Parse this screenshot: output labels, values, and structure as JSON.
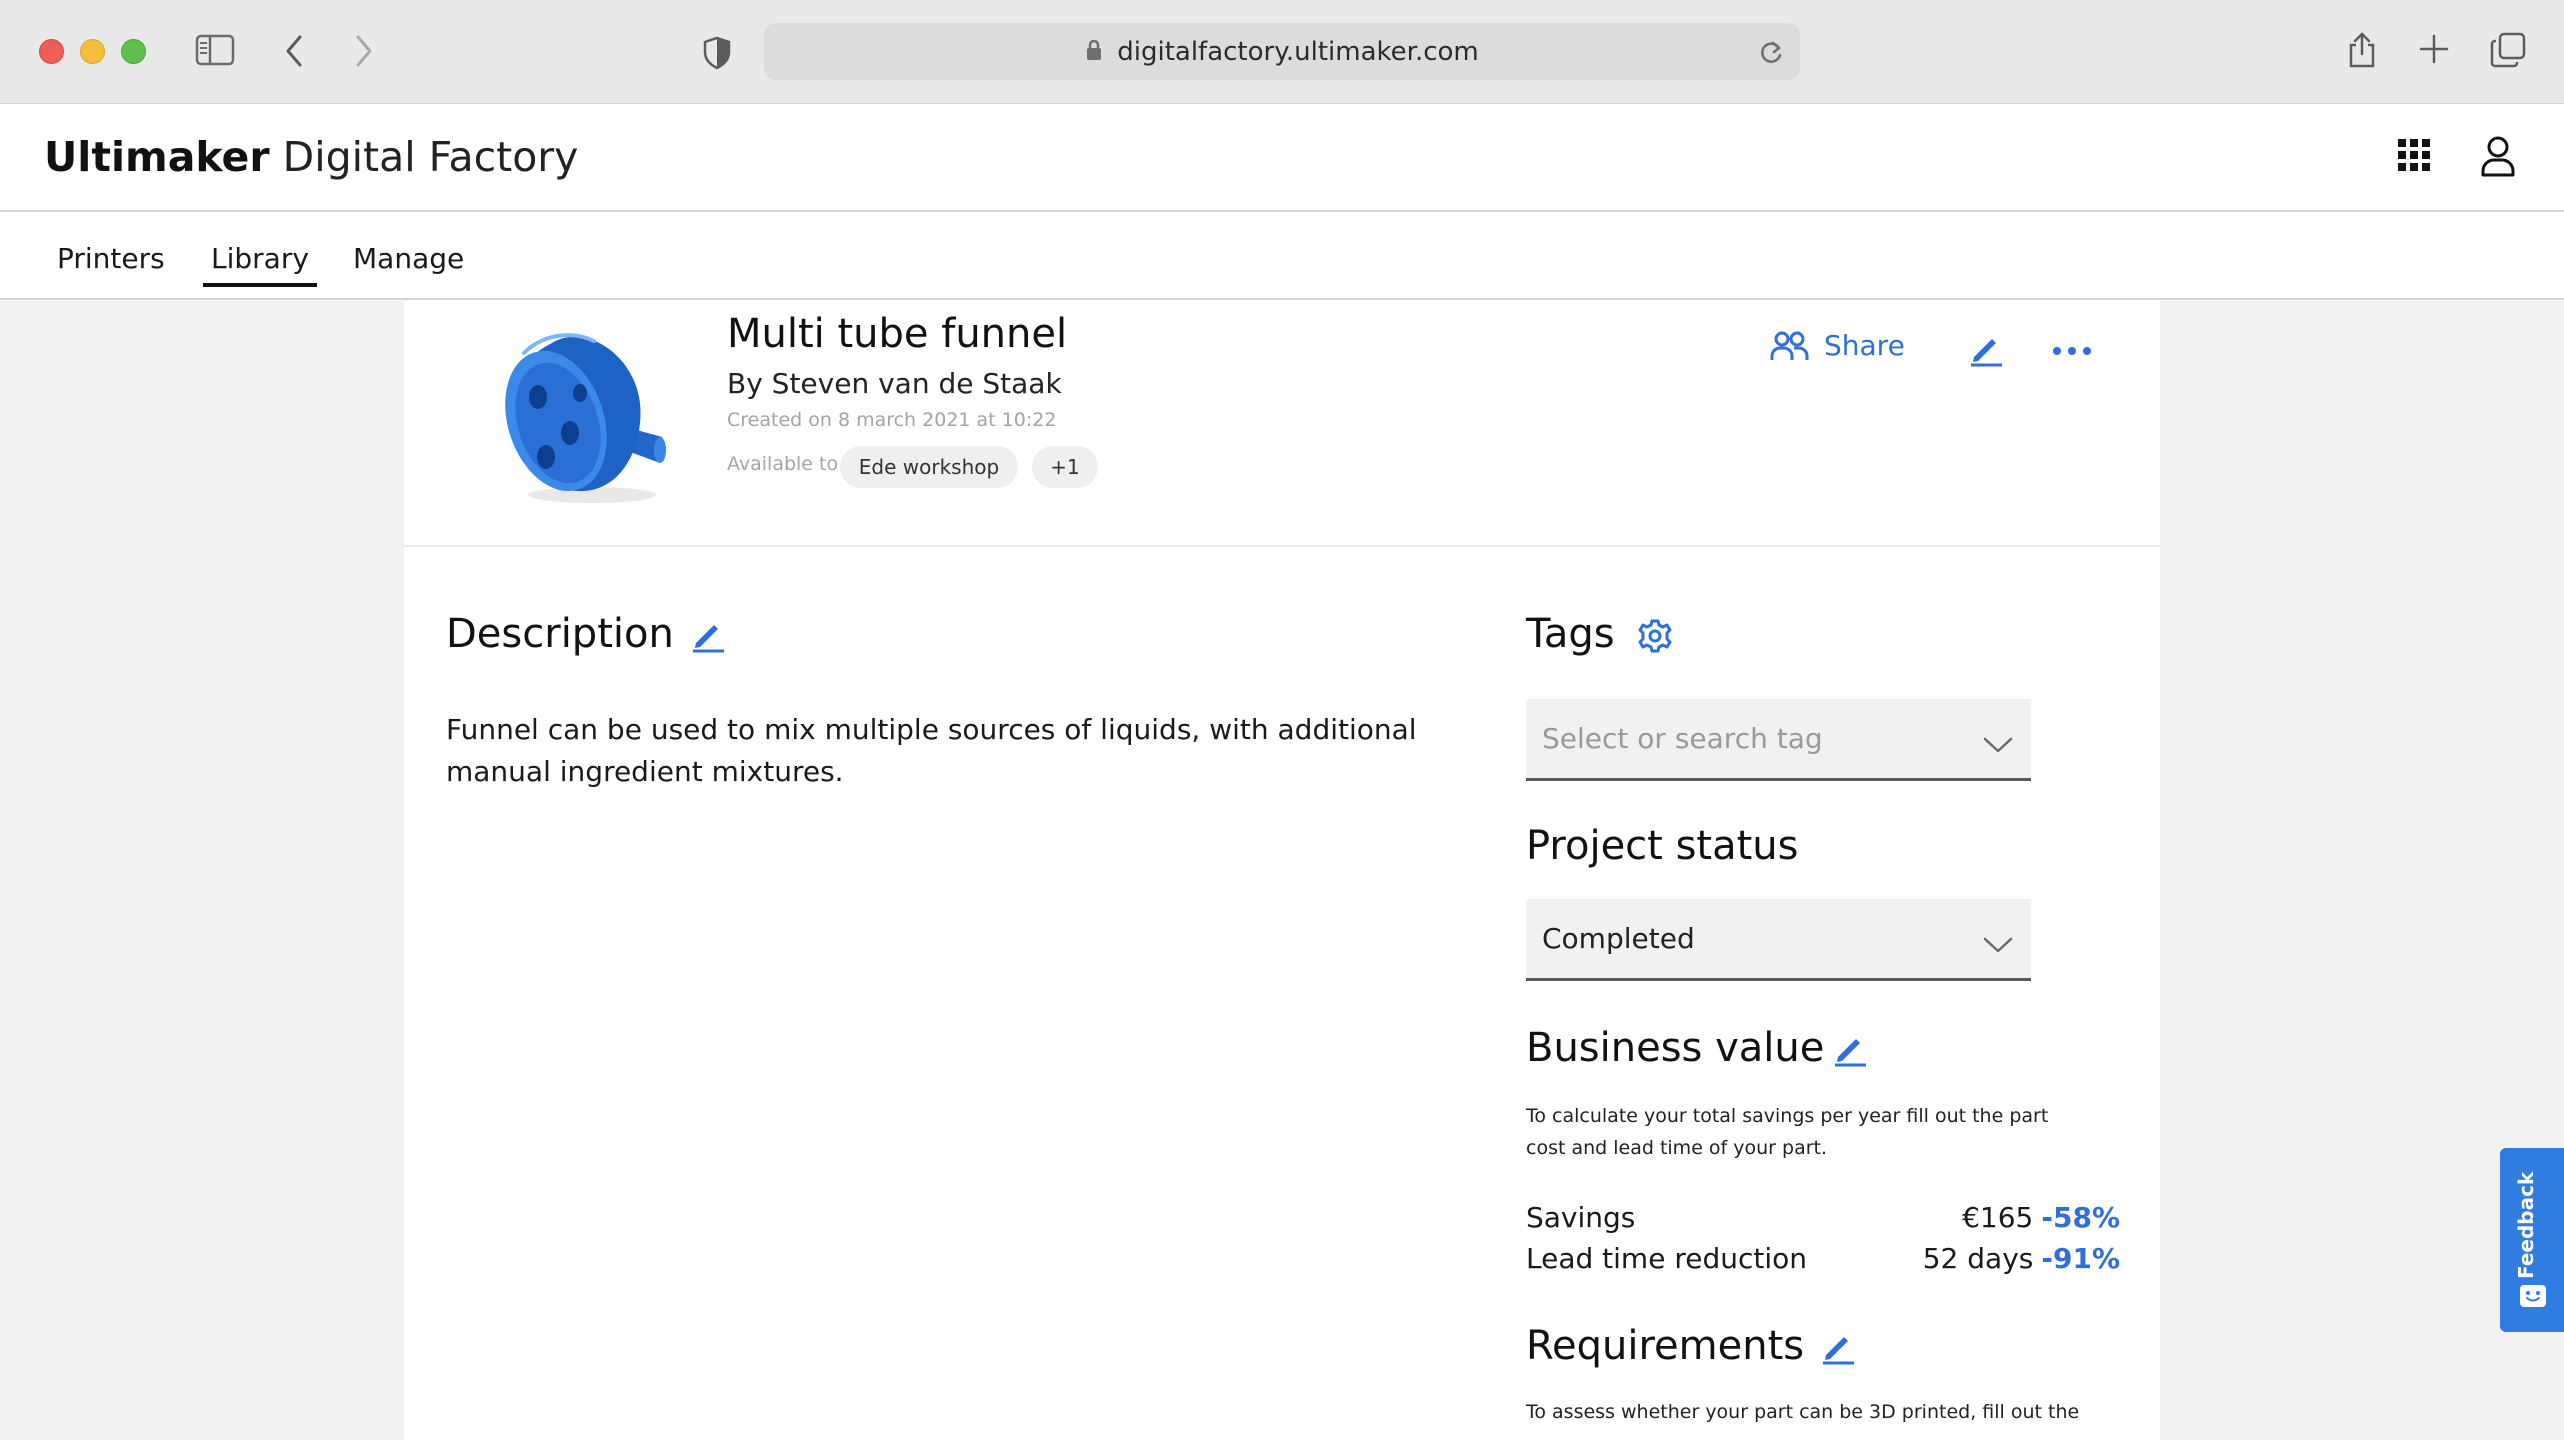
{
  "browser": {
    "url": "digitalfactory.ultimaker.com"
  },
  "app": {
    "brand_strong": "Ultimaker",
    "brand_light": "Digital Factory"
  },
  "nav": {
    "tabs": [
      {
        "label": "Printers"
      },
      {
        "label": "Library"
      },
      {
        "label": "Manage"
      }
    ],
    "active": "Library"
  },
  "project": {
    "title": "Multi tube funnel",
    "author": "By Steven van de Staak",
    "created": "Created on 8 march 2021 at 10:22",
    "available_label": "Available to",
    "available_chips": [
      "Ede workshop",
      "+1"
    ],
    "share_label": "Share"
  },
  "description": {
    "title": "Description",
    "text": "Funnel can be used to mix multiple sources of liquids, with additional manual ingredient mixtures."
  },
  "tags": {
    "title": "Tags",
    "placeholder": "Select or search tag"
  },
  "project_status": {
    "title": "Project status",
    "value": "Completed"
  },
  "business_value": {
    "title": "Business value",
    "note": "To calculate your total savings per year fill out the part cost and lead time of your part.",
    "rows": [
      {
        "label": "Savings",
        "value": "€165",
        "percent": "-58%"
      },
      {
        "label": "Lead time reduction",
        "value": "52 days",
        "percent": "-91%"
      }
    ]
  },
  "requirements": {
    "title": "Requirements",
    "note": "To assess whether your part can be 3D printed, fill out the"
  },
  "feedback": {
    "label": "Feedback"
  },
  "colors": {
    "accent": "#2f6fd9",
    "feedback_bg": "#2f7de1",
    "page_bg": "#f2f2f2"
  },
  "icons": [
    "sidebar-icon",
    "back-icon",
    "forward-icon",
    "privacy-shield-icon",
    "lock-icon",
    "reload-icon",
    "share-icon",
    "new-tab-icon",
    "tabs-overview-icon",
    "apps-grid-icon",
    "user-icon",
    "people-icon",
    "pencil-icon",
    "more-icon",
    "gear-icon",
    "chevron-down-icon",
    "feedback-smiley-icon"
  ]
}
